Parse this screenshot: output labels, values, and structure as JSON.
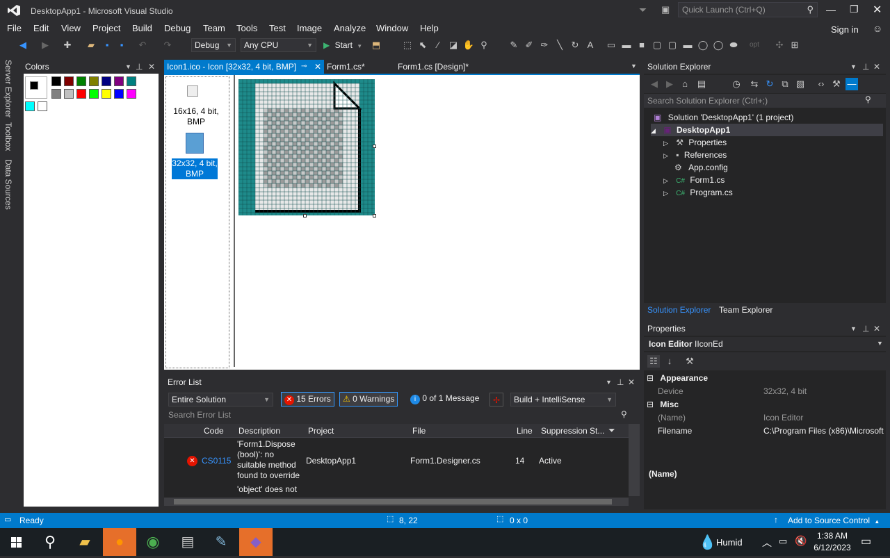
{
  "window": {
    "title": "DesktopApp1 - Microsoft Visual Studio",
    "quick_launch_placeholder": "Quick Launch (Ctrl+Q)"
  },
  "menu": [
    "File",
    "Edit",
    "View",
    "Project",
    "Build",
    "Debug",
    "Team",
    "Tools",
    "Test",
    "Image",
    "Analyze",
    "Window",
    "Help"
  ],
  "signin": "Sign in",
  "toolbar": {
    "config": "Debug",
    "platform": "Any CPU",
    "start": "Start",
    "opt_label": "opt"
  },
  "side_tabs": [
    "Server Explorer",
    "Toolbox",
    "Data Sources"
  ],
  "colors_panel": {
    "title": "Colors",
    "palette": [
      "#000000",
      "#800000",
      "#008000",
      "#808000",
      "#000080",
      "#800080",
      "#008080",
      "#808080",
      "#c0c0c0",
      "#ff0000",
      "#00ff00",
      "#ffff00",
      "#0000ff",
      "#ff00ff",
      "#00ffff",
      "#ffffff"
    ],
    "fg": "#000000",
    "bg": "#ffffff"
  },
  "doc_tabs": [
    {
      "label": "Icon1.ico - Icon [32x32, 4 bit, BMP]",
      "active": true
    },
    {
      "label": "Form1.cs*",
      "active": false
    },
    {
      "label": "Form1.cs [Design]*",
      "active": false
    }
  ],
  "icon_list": [
    {
      "label": "16x16, 4 bit, BMP",
      "selected": false
    },
    {
      "label": "32x32, 4 bit, BMP",
      "selected": true
    }
  ],
  "solution_explorer": {
    "title": "Solution Explorer",
    "search_placeholder": "Search Solution Explorer (Ctrl+;)",
    "solution": "Solution 'DesktopApp1' (1 project)",
    "project": "DesktopApp1",
    "items": [
      "Properties",
      "References",
      "App.config",
      "Form1.cs",
      "Program.cs"
    ],
    "tabs": [
      "Solution Explorer",
      "Team Explorer"
    ]
  },
  "properties": {
    "title": "Properties",
    "object_name": "Icon Editor",
    "object_type": "IIconEd",
    "categories": [
      {
        "name": "Appearance",
        "rows": [
          {
            "key": "Device",
            "value": "32x32, 4 bit"
          }
        ]
      },
      {
        "name": "Misc",
        "rows": [
          {
            "key": "(Name)",
            "value": "Icon Editor"
          },
          {
            "key": "Filename",
            "value": "C:\\Program Files (x86)\\Microsoft"
          }
        ]
      }
    ],
    "desc_title": "(Name)"
  },
  "error_list": {
    "title": "Error List",
    "scope": "Entire Solution",
    "errors": "15 Errors",
    "warnings": "0 Warnings",
    "messages": "0 of 1 Message",
    "build_filter": "Build + IntelliSense",
    "search_placeholder": "Search Error List",
    "columns": [
      "Code",
      "Description",
      "Project",
      "File",
      "Line",
      "Suppression St..."
    ],
    "rows": [
      {
        "code": "CS0115",
        "description": "'Form1.Dispose (bool)': no suitable method found to override",
        "project": "DesktopApp1",
        "file": "Form1.Designer.cs",
        "line": "14",
        "suppression": "Active"
      }
    ],
    "next_desc": "'object' does not"
  },
  "status": {
    "ready": "Ready",
    "cursor": "8, 22",
    "size": "0 x 0",
    "source_control": "Add to Source Control"
  },
  "taskbar": {
    "weather": "Humid",
    "time": "1:38 AM",
    "date": "6/12/2023"
  }
}
